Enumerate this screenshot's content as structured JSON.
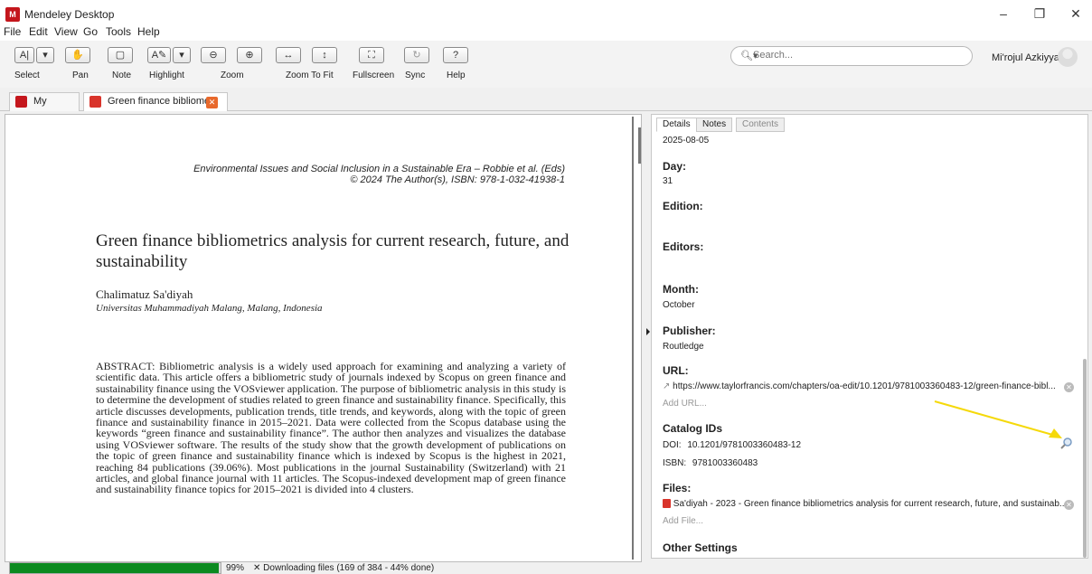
{
  "window": {
    "title": "Mendeley Desktop",
    "logo": "Mendeley"
  },
  "menu": [
    "File",
    "Edit",
    "View",
    "Go",
    "Tools",
    "Help"
  ],
  "toolbar": {
    "select_label": "Select",
    "pan_label": "Pan",
    "note_label": "Note",
    "highlight_label": "Highlight",
    "zoom_label": "Zoom",
    "zoom_fit_label": "Zoom To Fit",
    "fullscreen_label": "Fullscreen",
    "sync_label": "Sync",
    "help_label": "Help"
  },
  "search": {
    "placeholder": "Search..."
  },
  "user": {
    "name": "Mi'rojul Azkiyyah"
  },
  "tabs": [
    {
      "label": "My Library"
    },
    {
      "label": "Green finance bibliome..."
    }
  ],
  "pdf": {
    "header_line1": "Environmental Issues and Social Inclusion in a Sustainable Era – Robbie et al. (Eds)",
    "header_line2": "© 2024 The Author(s), ISBN: 978-1-032-41938-1",
    "title": "Green finance bibliometrics analysis for current research, future, and sustainability",
    "author": "Chalimatuz Sa'diyah",
    "affiliation": "Universitas Muhammadiyah Malang, Malang, Indonesia",
    "abstract": "ABSTRACT:  Bibliometric analysis is a widely used approach for examining and analyzing a variety of scientific data. This article offers a bibliometric study of journals indexed by Scopus on green finance and sustainability finance using the VOSviewer application. The purpose of bibliometric analysis in this study is to determine the development of studies related to green finance and sustainability finance. Specifically, this article discusses developments, publication trends, title trends, and keywords, along with the topic of green finance and sustainability finance in 2015–2021. Data were collected from the Scopus database using the keywords “green finance and sustainability finance”. The author then analyzes and visualizes the database using VOSviewer software. The results of the study show that the growth development of publications on the topic of green finance and sustainability finance which is indexed by Scopus is the highest in 2021, reaching 84 publications (39.06%). Most publications in the journal Sustainability (Switzerland) with 21 articles, and global finance journal with 11 articles. The Scopus-indexed development map of green finance and sustainability finance topics for 2015–2021 is divided into 4 clusters."
  },
  "details": {
    "tabs": [
      "Details",
      "Notes",
      "Contents"
    ],
    "accessed_value": "2025-08-05",
    "day_label": "Day:",
    "day_value": "31",
    "edition_label": "Edition:",
    "editors_label": "Editors:",
    "month_label": "Month:",
    "month_value": "October",
    "publisher_label": "Publisher:",
    "publisher_value": "Routledge",
    "url_label": "URL:",
    "url_value": "https://www.taylorfrancis.com/chapters/oa-edit/10.1201/9781003360483-12/green-finance-bibl...",
    "add_url": "Add URL...",
    "catalog_label": "Catalog IDs",
    "doi_key": "DOI:",
    "doi_value": "10.1201/9781003360483-12",
    "isbn_key": "ISBN:",
    "isbn_value": "9781003360483",
    "files_label": "Files:",
    "file_value": "Sa'diyah - 2023 - Green finance bibliometrics analysis for current research, future, and sustainab...",
    "add_file": "Add File...",
    "other_label": "Other Settings"
  },
  "status": {
    "progress_percent": 99,
    "progress_text": "99%",
    "download_text": "✕ Downloading files (169 of 384 - 44% done)"
  },
  "colors": {
    "accent": "#c4161c",
    "progress": "#0b8a1f",
    "annotation_arrow": "#f5d90a"
  }
}
